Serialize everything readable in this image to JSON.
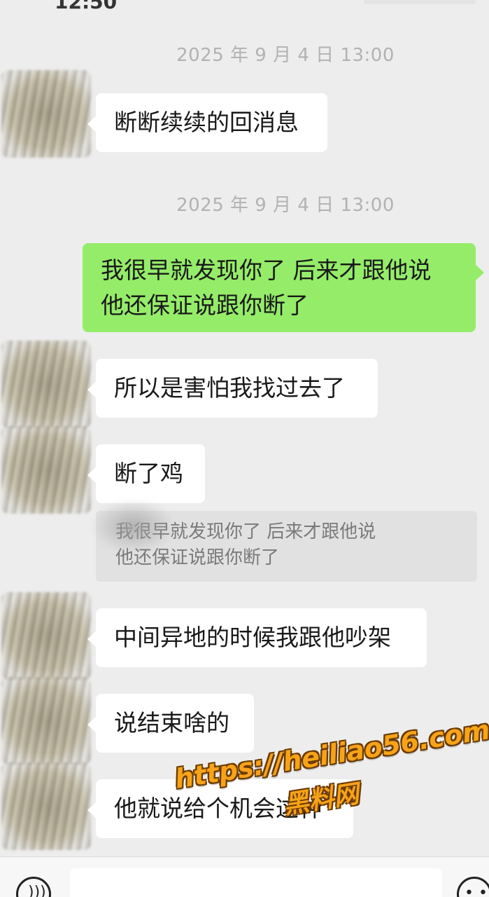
{
  "status_bar": {
    "time": "12:50"
  },
  "messages": [
    {
      "kind": "timestamp",
      "text": "2025 年 9 月 4 日 13:00"
    },
    {
      "kind": "incoming",
      "text": "断断续续的回消息"
    },
    {
      "kind": "timestamp",
      "text": "2025 年 9 月 4 日 13:00"
    },
    {
      "kind": "outgoing",
      "lines": [
        "我很早就发现你了 后来才跟他说",
        "他还保证说跟你断了"
      ]
    },
    {
      "kind": "incoming",
      "text": "所以是害怕我找过去了"
    },
    {
      "kind": "incoming",
      "text": "断了鸡"
    },
    {
      "kind": "quote",
      "lines": [
        "我很早就发现你了 后来才跟他说",
        "他还保证说跟你断了"
      ]
    },
    {
      "kind": "incoming",
      "text": "中间异地的时候我跟他吵架"
    },
    {
      "kind": "incoming",
      "text": "说结束啥的"
    },
    {
      "kind": "incoming",
      "text": "他就说给个机会这种"
    }
  ],
  "input_bar": {
    "voice_icon": "voice-icon",
    "emoji_icon": "emoji-icon"
  },
  "watermark": {
    "url": "https://heiliao56.com",
    "name": "黑料网"
  },
  "colors": {
    "background": "#ededed",
    "outgoing_bubble": "#95ec69",
    "incoming_bubble": "#ffffff",
    "timestamp": "#b2b2b2",
    "watermark": "#f7a318"
  }
}
